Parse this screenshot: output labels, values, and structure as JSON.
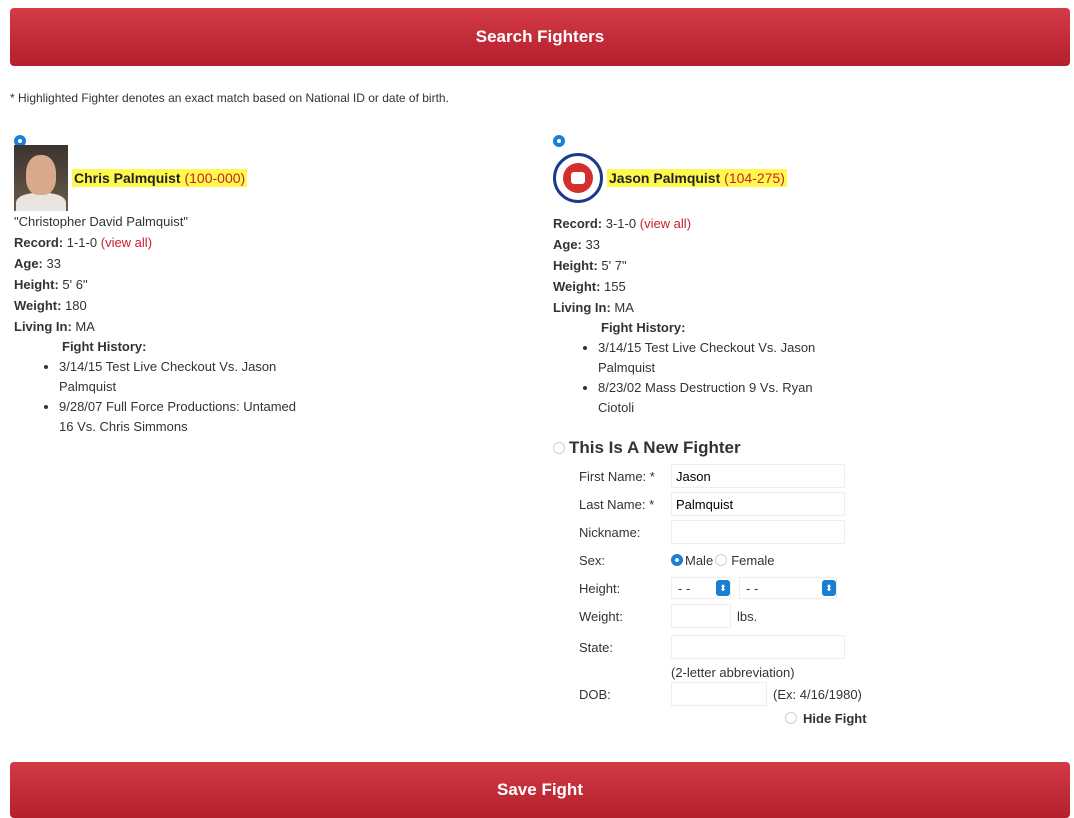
{
  "buttons": {
    "search": "Search Fighters",
    "save": "Save Fight"
  },
  "note": "* Highlighted Fighter denotes an exact match based on National ID or date of birth.",
  "fighters": [
    {
      "name": "Chris Palmquist",
      "id": "(100-000)",
      "nickname": "\"Christopher David Palmquist\"",
      "record_label": "Record:",
      "record": "1-1-0",
      "view_all": "(view all)",
      "age_label": "Age:",
      "age": "33",
      "height_label": "Height:",
      "height": "5' 6\"",
      "weight_label": "Weight:",
      "weight": "180",
      "living_label": "Living In:",
      "living": "MA",
      "history_title": "Fight History:",
      "history": [
        "3/14/15 Test Live Checkout Vs. Jason Palmquist",
        "9/28/07 Full Force Productions: Untamed 16 Vs. Chris Simmons"
      ]
    },
    {
      "name": "Jason Palmquist",
      "id": "(104-275)",
      "record_label": "Record:",
      "record": "3-1-0",
      "view_all": "(view all)",
      "age_label": "Age:",
      "age": "33",
      "height_label": "Height:",
      "height": "5' 7\"",
      "weight_label": "Weight:",
      "weight": "155",
      "living_label": "Living In:",
      "living": "MA",
      "history_title": "Fight History:",
      "history": [
        "3/14/15 Test Live Checkout Vs. Jason Palmquist",
        "8/23/02 Mass Destruction 9 Vs. Ryan Ciotoli"
      ]
    }
  ],
  "new_fighter": {
    "title": "This Is A New Fighter",
    "first_name_label": "First Name: *",
    "first_name": "Jason",
    "last_name_label": "Last Name: *",
    "last_name": "Palmquist",
    "nickname_label": "Nickname:",
    "nickname": "",
    "sex_label": "Sex:",
    "male": "Male",
    "female": "Female",
    "height_label": "Height:",
    "height_ft": "- -",
    "height_in": "- -",
    "weight_label": "Weight:",
    "weight_unit": "lbs.",
    "state_label": "State:",
    "state_hint": "(2-letter abbreviation)",
    "dob_label": "DOB:",
    "dob_hint": "(Ex: 4/16/1980)",
    "hide_fight": "Hide Fight"
  },
  "colors": {
    "accent": "#c8202e",
    "highlight": "#fff94d",
    "radio": "#1a7fd4"
  }
}
